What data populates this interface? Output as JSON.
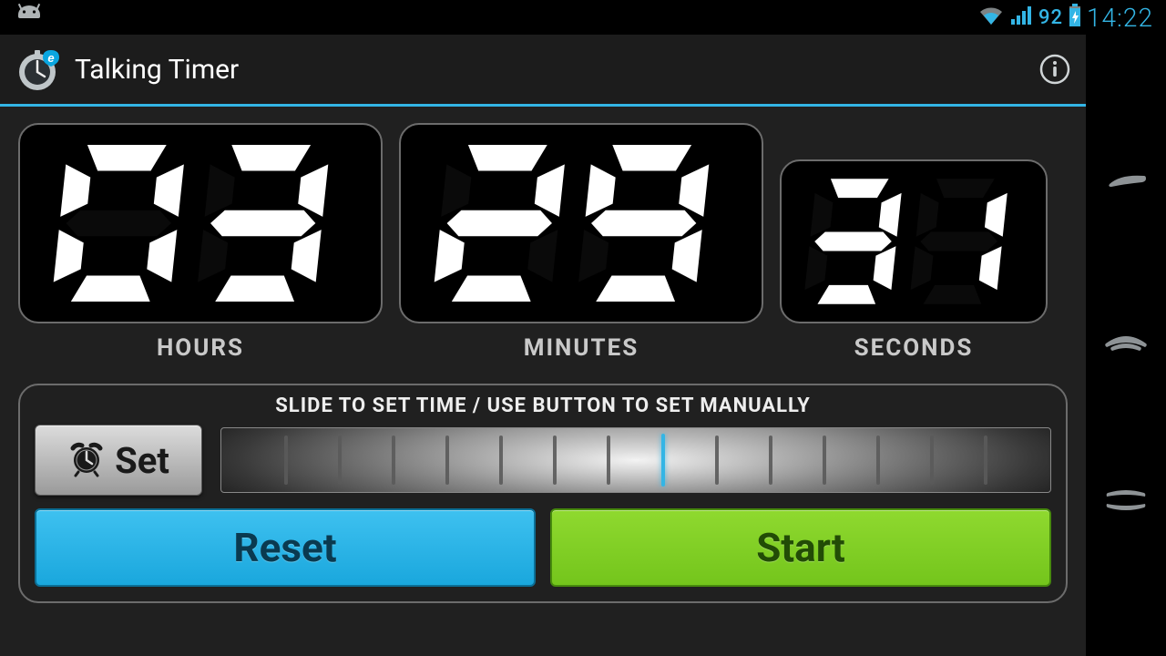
{
  "status": {
    "battery_percent": "92",
    "clock": "14:22"
  },
  "actionbar": {
    "title": "Talking Timer"
  },
  "timer": {
    "hours": "03",
    "minutes": "29",
    "seconds": "31",
    "labels": {
      "hours": "HOURS",
      "minutes": "MINUTES",
      "seconds": "SECONDS"
    }
  },
  "controls": {
    "hint": "SLIDE TO SET TIME / USE BUTTON TO SET MANUALLY",
    "set_label": "Set",
    "reset_label": "Reset",
    "start_label": "Start"
  },
  "colors": {
    "accent": "#33b5e5",
    "start": "#7bc926",
    "reset": "#2ab4e6"
  }
}
